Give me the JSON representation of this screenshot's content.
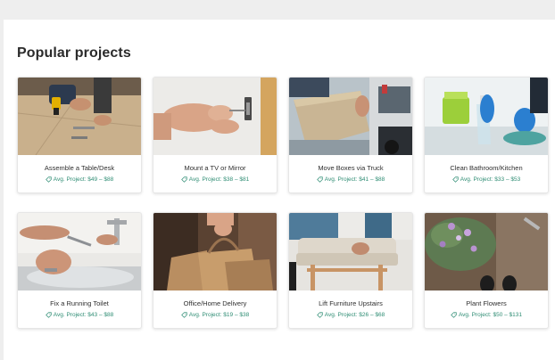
{
  "section": {
    "title": "Popular projects"
  },
  "projects": [
    {
      "title": "Assemble a Table/Desk",
      "price": "Avg. Project: $49 – $88",
      "image": "assemble-table-photo"
    },
    {
      "title": "Mount a TV or Mirror",
      "price": "Avg. Project: $38 – $81",
      "image": "mount-tv-photo"
    },
    {
      "title": "Move Boxes via Truck",
      "price": "Avg. Project: $41 – $88",
      "image": "move-boxes-photo"
    },
    {
      "title": "Clean Bathroom/Kitchen",
      "price": "Avg. Project: $33 – $53",
      "image": "clean-bathroom-photo"
    },
    {
      "title": "Fix a Running Toilet",
      "price": "Avg. Project: $43 – $88",
      "image": "fix-toilet-photo"
    },
    {
      "title": "Office/Home Delivery",
      "price": "Avg. Project: $19 – $38",
      "image": "delivery-photo"
    },
    {
      "title": "Lift Furniture Upstairs",
      "price": "Avg. Project: $26 – $68",
      "image": "lift-furniture-photo"
    },
    {
      "title": "Plant Flowers",
      "price": "Avg. Project: $50 – $131",
      "image": "plant-flowers-photo"
    }
  ],
  "colors": {
    "price_accent": "#2f8d74",
    "title_text": "#2b2b2b",
    "page_background": "#eeeeee"
  },
  "icons": {
    "price": "tag-icon"
  }
}
